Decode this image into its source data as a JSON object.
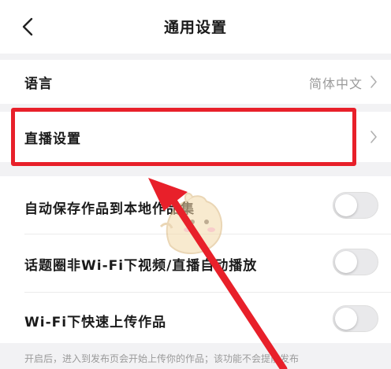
{
  "header": {
    "title": "通用设置",
    "back_icon": "chevron-left-icon"
  },
  "settings": {
    "language": {
      "label": "语言",
      "value": "简体中文"
    },
    "live": {
      "label": "直播设置"
    },
    "auto_save": {
      "label": "自动保存作品到本地作品集",
      "enabled": false
    },
    "topic_autoplay": {
      "label": "话题圈非Wi-Fi下视频/直播自动播放",
      "enabled": false
    },
    "wifi_upload": {
      "label": "Wi-Fi下快速上传作品",
      "enabled": false
    }
  },
  "footnote": "开启后，进入到发布页会开始上传你的作品；该功能不会提前发布",
  "annotation": {
    "highlight_color": "#e8202a",
    "arrow_color": "#e8202a"
  }
}
